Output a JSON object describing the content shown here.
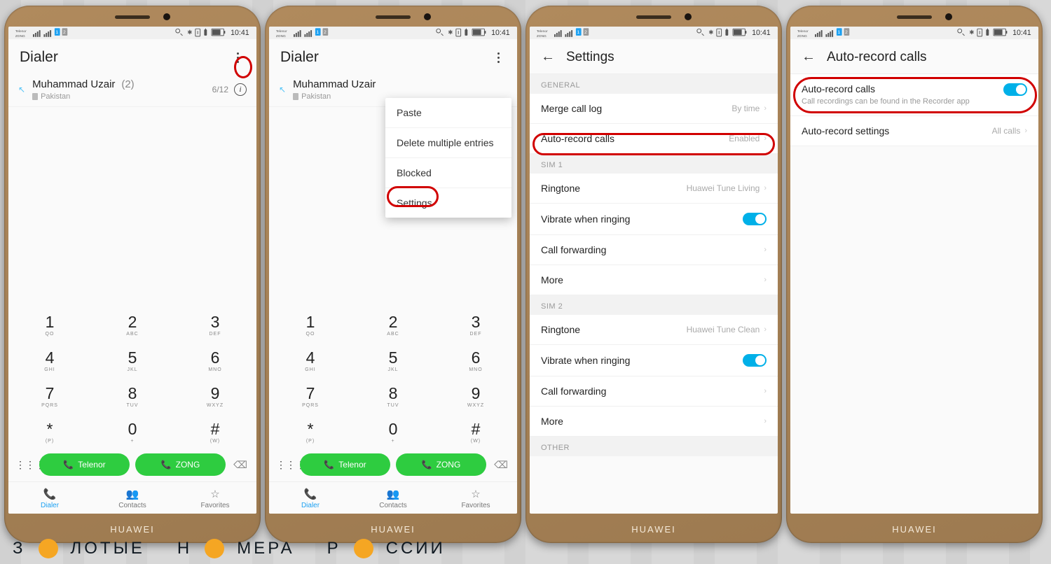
{
  "status": {
    "carrier1": "Telenor",
    "carrier2": "ZONG",
    "time": "10:41"
  },
  "phone1": {
    "title": "Dialer",
    "call": {
      "name": "Muhammad Uzair",
      "count": "(2)",
      "country": "Pakistan",
      "date": "6/12"
    }
  },
  "menu": {
    "paste": "Paste",
    "delete": "Delete multiple entries",
    "blocked": "Blocked",
    "settings": "Settings"
  },
  "keypad": {
    "k1": {
      "d": "1",
      "l": "QO"
    },
    "k2": {
      "d": "2",
      "l": "ABC"
    },
    "k3": {
      "d": "3",
      "l": "DEF"
    },
    "k4": {
      "d": "4",
      "l": "GHI"
    },
    "k5": {
      "d": "5",
      "l": "JKL"
    },
    "k6": {
      "d": "6",
      "l": "MNO"
    },
    "k7": {
      "d": "7",
      "l": "PQRS"
    },
    "k8": {
      "d": "8",
      "l": "TUV"
    },
    "k9": {
      "d": "9",
      "l": "WXYZ"
    },
    "kstar": {
      "d": "*",
      "l": "(P)"
    },
    "k0": {
      "d": "0",
      "l": "+"
    },
    "khash": {
      "d": "#",
      "l": "(W)"
    }
  },
  "sim": {
    "a": "Telenor",
    "b": "ZONG"
  },
  "tabs": {
    "dialer": "Dialer",
    "contacts": "Contacts",
    "fav": "Favorites"
  },
  "settings": {
    "title": "Settings",
    "general": "GENERAL",
    "merge": {
      "label": "Merge call log",
      "val": "By time"
    },
    "autorec": {
      "label": "Auto-record calls",
      "val": "Enabled"
    },
    "sim1": "SIM 1",
    "ring1": {
      "label": "Ringtone",
      "val": "Huawei Tune Living"
    },
    "vibrate": "Vibrate when ringing",
    "fwd": "Call forwarding",
    "more": "More",
    "sim2": "SIM 2",
    "ring2": {
      "label": "Ringtone",
      "val": "Huawei Tune Clean"
    },
    "other": "OTHER"
  },
  "autorec": {
    "title": "Auto-record calls",
    "row1": {
      "label": "Auto-record calls",
      "sub": "Call recordings can be found in the Recorder app"
    },
    "row2": {
      "label": "Auto-record settings",
      "val": "All calls"
    }
  },
  "brand": "HUAWEI",
  "watermark": {
    "a": "З",
    "b": "ЛОТЫЕ",
    "c": "Н",
    "d": "МЕРА",
    "e": "Р",
    "f": "ССИИ"
  }
}
